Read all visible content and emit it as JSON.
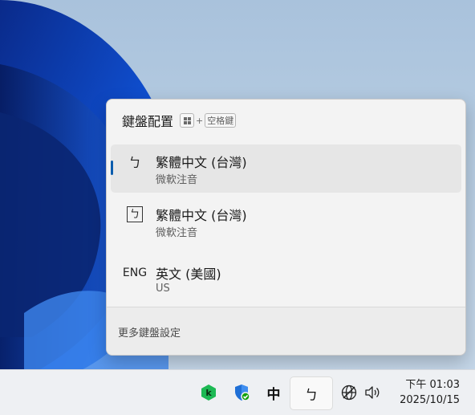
{
  "flyout": {
    "title": "鍵盤配置",
    "shortcut": {
      "plus": "+",
      "key_label": "空格鍵"
    },
    "layouts": [
      {
        "icon_text": "ㄅ",
        "name": "繁體中文 (台灣)",
        "sub": "微軟注音",
        "selected": true
      },
      {
        "icon_text": "ㄅ",
        "name": "繁體中文 (台灣)",
        "sub": "微軟注音",
        "selected": false
      },
      {
        "icon_text": "ENG",
        "name": "英文 (美國)",
        "sub": "US",
        "selected": false
      }
    ],
    "more_settings": "更多鍵盤設定"
  },
  "taskbar": {
    "ime_mode": "中",
    "ime_layout": "ㄅ",
    "icons": [
      "kaspersky-icon",
      "windows-security-icon",
      "network-globe-icon",
      "volume-icon"
    ],
    "clock": {
      "time": "下午 01:03",
      "date": "2025/10/15"
    }
  },
  "colors": {
    "accent": "#0b5cad",
    "flyout_bg": "#f3f3f3",
    "selected_bg": "#e6e6e6",
    "kaspersky_green": "#1db954",
    "security_blue": "#1f6fd6"
  }
}
